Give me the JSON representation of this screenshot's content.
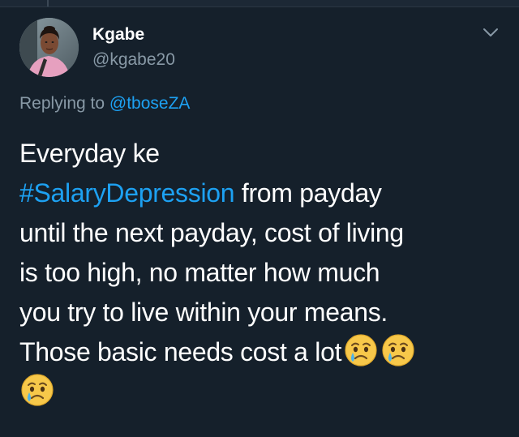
{
  "tweet": {
    "user": {
      "name": "Kgabe",
      "handle": "@kgabe20"
    },
    "reply": {
      "prefix": "Replying to ",
      "target": "@tboseZA"
    },
    "body": {
      "line1": "Everyday ke",
      "hashtag": "#SalaryDepression",
      "line2_rest": " from payday",
      "line3": "until the next payday, cost of living",
      "line4": "is too high, no matter how much",
      "line5": "you try to live within your means.",
      "line6": "Those basic needs cost a lot"
    },
    "emoji": {
      "name": "crying-face",
      "count": 3
    }
  },
  "colors": {
    "background": "#15202b",
    "text": "#ffffff",
    "secondary_text": "#8899a6",
    "accent": "#1da1f2"
  },
  "icons": {
    "menu": "chevron-down-icon"
  }
}
